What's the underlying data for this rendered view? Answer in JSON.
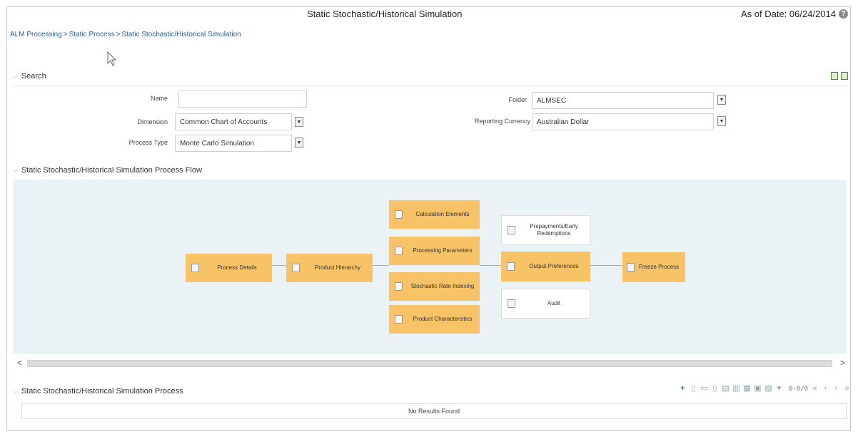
{
  "header": {
    "title": "Static Stochastic/Historical Simulation",
    "as_of": "As of Date: 06/24/2014"
  },
  "breadcrumb": [
    "ALM Processing",
    "Static Process",
    "Static Stochastic/Historical Simulation"
  ],
  "search": {
    "section_label": "Search",
    "fields": {
      "name": {
        "label": "Name",
        "value": ""
      },
      "dimension": {
        "label": "Dimension",
        "value": "Common Chart of Accounts"
      },
      "process_type": {
        "label": "Process Type",
        "value": "Monte Carlo Simulation"
      },
      "folder": {
        "label": "Folder",
        "value": "ALMSEC"
      },
      "reporting_currency": {
        "label": "Reporting Currency",
        "value": "Australian Dollar"
      }
    }
  },
  "flow": {
    "section_label": "Static Stochastic/Historical Simulation Process Flow",
    "nodes": {
      "process_details": "Process Details",
      "product_hierarchy": "Product Hierarchy",
      "calculation_elements": "Calculation Elements",
      "processing_parameters": "Processing Parameters",
      "stochastic_rate_indexing": "Stochastic Rate Indexing",
      "product_characteristics": "Product Characteristics",
      "prepayments": "Prepayments/Early Redemptions",
      "output_preferences": "Output Preferences",
      "audit": "Audit",
      "freeze_process": "Freeze Process"
    }
  },
  "process_list": {
    "section_label": "Static Stochastic/Historical Simulation Process",
    "pager": "0-0/0",
    "empty_text": "No Results Found"
  }
}
